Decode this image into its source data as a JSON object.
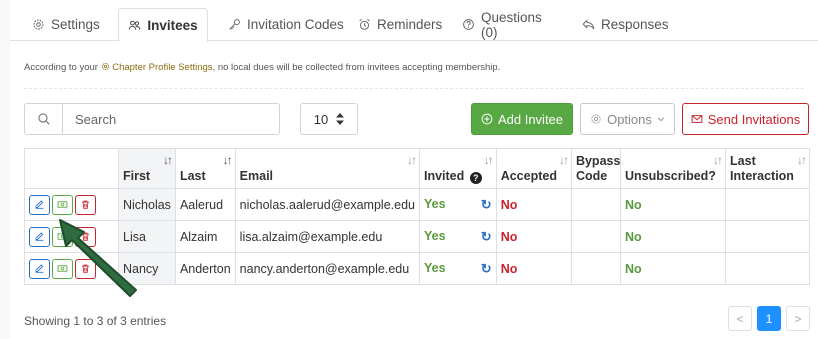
{
  "tabs": [
    {
      "label": "Settings",
      "icon": "gear-icon"
    },
    {
      "label": "Invitees",
      "icon": "users-icon"
    },
    {
      "label": "Invitation Codes",
      "icon": "key-icon"
    },
    {
      "label": "Reminders",
      "icon": "alarm-icon"
    },
    {
      "label": "Questions (0)",
      "icon": "question-icon"
    },
    {
      "label": "Responses",
      "icon": "reply-icon"
    }
  ],
  "active_tab": "Invitees",
  "notice": {
    "prefix": "According to your",
    "link": "Chapter Profile Settings",
    "suffix": ", no local dues will be collected from invitees accepting membership."
  },
  "search": {
    "placeholder": "Search",
    "value": ""
  },
  "per_page": "10",
  "buttons": {
    "add": "Add Invitee",
    "options": "Options",
    "send": "Send Invitations"
  },
  "columns": [
    "",
    "First",
    "Last",
    "Email",
    "Invited",
    "Accepted",
    "Bypass Code",
    "Unsubscribed?",
    "Last Interaction"
  ],
  "rows": [
    {
      "first": "Nicholas",
      "last": "Aalerud",
      "email": "nicholas.aalerud@example.edu",
      "invited": "Yes",
      "accepted": "No",
      "bypass": "",
      "unsubscribed": "No",
      "last_interaction": ""
    },
    {
      "first": "Lisa",
      "last": "Alzaim",
      "email": "lisa.alzaim@example.edu",
      "invited": "Yes",
      "accepted": "No",
      "bypass": "",
      "unsubscribed": "No",
      "last_interaction": ""
    },
    {
      "first": "Nancy",
      "last": "Anderton",
      "email": "nancy.anderton@example.edu",
      "invited": "Yes",
      "accepted": "No",
      "bypass": "",
      "unsubscribed": "No",
      "last_interaction": ""
    }
  ],
  "footer": {
    "showing": "Showing 1 to 3 of 3 entries",
    "prev": "<",
    "current_page": "1",
    "next": ">"
  },
  "colors": {
    "accent_green": "#58a843",
    "danger_red": "#c8232c",
    "link_blue": "#2a6fc9",
    "page_blue": "#1e90ff",
    "annotation_arrow": "#2e6b3f"
  }
}
